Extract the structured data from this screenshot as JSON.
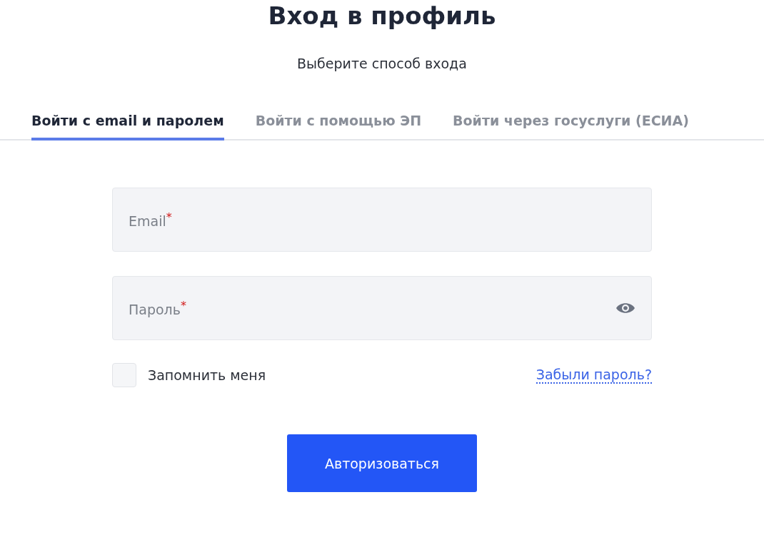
{
  "title": "Вход в профиль",
  "subtitle": "Выберите способ входа",
  "tabs": [
    {
      "label": "Войти с email и паролем",
      "selected": true
    },
    {
      "label": "Войти с помощью ЭП",
      "selected": false
    },
    {
      "label": "Войти через госуслуги (ЕСИА)",
      "selected": false
    }
  ],
  "fields": [
    {
      "kind": "text",
      "placeholder": "Email$^{*}$"
    },
    {
      "kind": "password",
      "placeholder": "Пароль$^{*}$"
    }
  ],
  "remember": {
    "label": "Запомнить меня",
    "checked": false
  },
  "forgot_link": "Забыли пароль?",
  "submit": "Авторизоваться"
}
